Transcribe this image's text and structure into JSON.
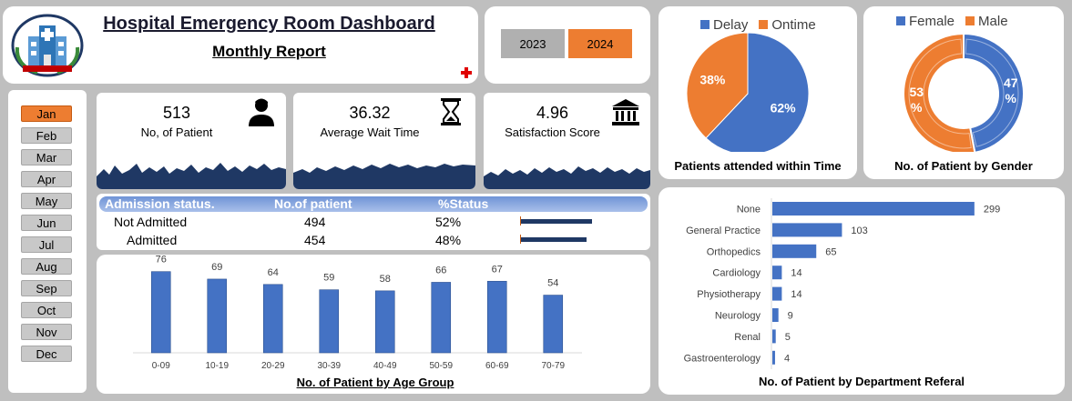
{
  "header": {
    "title": "Hospital Emergency Room Dashboard",
    "subtitle": "Monthly Report"
  },
  "years": [
    "2023",
    "2024"
  ],
  "selected_year": "2024",
  "months": [
    "Jan",
    "Feb",
    "Mar",
    "Apr",
    "May",
    "Jun",
    "Jul",
    "Aug",
    "Sep",
    "Oct",
    "Nov",
    "Dec"
  ],
  "selected_month": "Jan",
  "kpis": {
    "patients": {
      "value": "513",
      "label": "No, of Patient"
    },
    "wait": {
      "value": "36.32",
      "label": "Average Wait Time"
    },
    "satisfaction": {
      "value": "4.96",
      "label": "Satisfaction Score"
    }
  },
  "admission": {
    "headers": [
      "Admission status.",
      "No.of patient",
      "%Status"
    ],
    "rows": [
      {
        "status": "Not Admitted",
        "count": "494",
        "pct": "52%",
        "fraction": 0.52
      },
      {
        "status": "Admitted",
        "count": "454",
        "pct": "48%",
        "fraction": 0.48
      }
    ]
  },
  "colors": {
    "blue": "#4472c4",
    "orange": "#ed7d31",
    "navy": "#1f3864"
  },
  "icons": {
    "logo": "hospital-logo-icon",
    "patient": "person-icon",
    "wait": "hourglass-icon",
    "satisfaction": "institution-icon",
    "red": "red-cross-icon"
  },
  "chart_data": [
    {
      "type": "bar",
      "title": "No. of Patient by Age Group",
      "categories": [
        "0-09",
        "10-19",
        "20-29",
        "30-39",
        "40-49",
        "50-59",
        "60-69",
        "70-79"
      ],
      "values": [
        76,
        69,
        64,
        59,
        58,
        66,
        67,
        54
      ],
      "ylim": [
        0,
        80
      ]
    },
    {
      "type": "pie",
      "title": "Patients attended within Time",
      "series": [
        {
          "name": "Delay",
          "value": 62,
          "label": "62%"
        },
        {
          "name": "Ontime",
          "value": 38,
          "label": "38%"
        }
      ]
    },
    {
      "type": "pie",
      "title": "No. of Patient by Gender",
      "series": [
        {
          "name": "Female",
          "value": 47,
          "label": "47 %"
        },
        {
          "name": "Male",
          "value": 53,
          "label": "53 %"
        }
      ]
    },
    {
      "type": "bar",
      "orientation": "horizontal",
      "title": "No. of Patient by Department Referal",
      "categories": [
        "None",
        "General Practice",
        "Orthopedics",
        "Cardiology",
        "Physiotherapy",
        "Neurology",
        "Renal",
        "Gastroenterology"
      ],
      "values": [
        299,
        103,
        65,
        14,
        14,
        9,
        5,
        4
      ],
      "xlim": [
        0,
        310
      ]
    }
  ]
}
